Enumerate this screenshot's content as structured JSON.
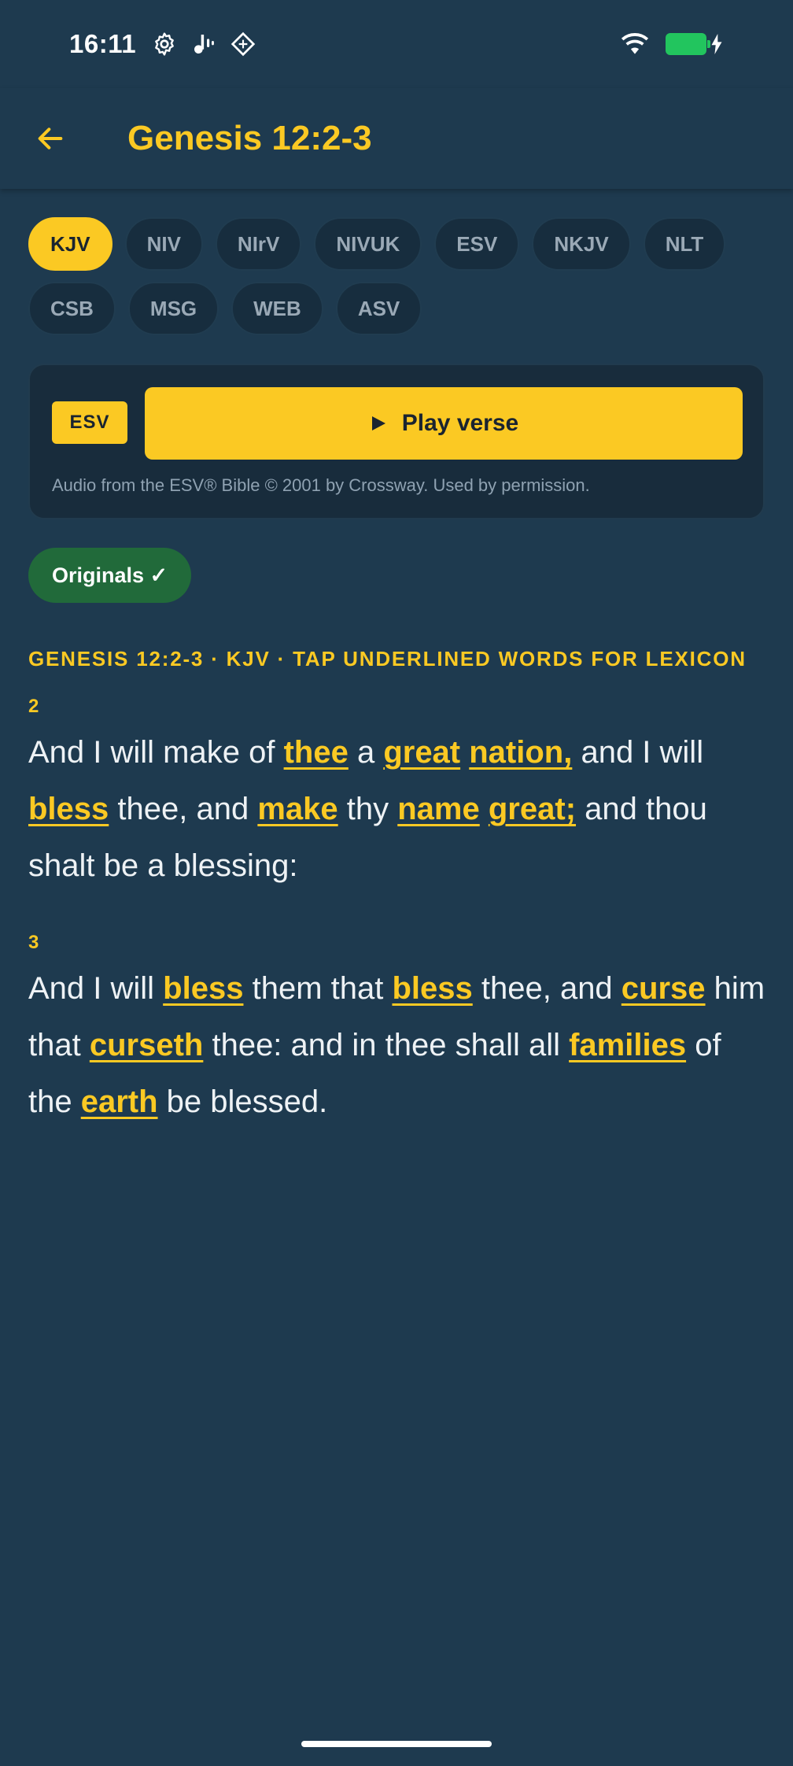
{
  "status": {
    "time": "16:11",
    "icons": [
      "settings-gear-icon",
      "audio-waves-icon",
      "diamond-grid-icon",
      "wifi-icon",
      "battery-charging-icon"
    ]
  },
  "appbar": {
    "title": "Genesis 12:2-3"
  },
  "translations": [
    "KJV",
    "NIV",
    "NIrV",
    "NIVUK",
    "ESV",
    "NKJV",
    "NLT",
    "CSB",
    "MSG",
    "WEB",
    "ASV"
  ],
  "selected_translation": "KJV",
  "audio": {
    "badge": "ESV",
    "play_label": "Play verse",
    "attribution": "Audio from the ESV® Bible © 2001 by Crossway. Used by permission."
  },
  "originals_label": "Originals ✓",
  "reference_header": "GENESIS 12:2-3 · KJV  ·  TAP UNDERLINED WORDS FOR LEXICON",
  "verses": [
    {
      "number": "2",
      "segments": [
        {
          "t": "And I will make of "
        },
        {
          "t": "thee",
          "lex": true
        },
        {
          "t": " a "
        },
        {
          "t": "great",
          "lex": true
        },
        {
          "t": " "
        },
        {
          "t": "nation,",
          "lex": true
        },
        {
          "t": " and I will "
        },
        {
          "t": "bless",
          "lex": true
        },
        {
          "t": " thee, and "
        },
        {
          "t": "make",
          "lex": true
        },
        {
          "t": " thy "
        },
        {
          "t": "name",
          "lex": true
        },
        {
          "t": " "
        },
        {
          "t": "great;",
          "lex": true
        },
        {
          "t": " and thou shalt be a blessing:"
        }
      ]
    },
    {
      "number": "3",
      "segments": [
        {
          "t": "And I will "
        },
        {
          "t": "bless",
          "lex": true
        },
        {
          "t": " them that "
        },
        {
          "t": "bless",
          "lex": true
        },
        {
          "t": " thee, and "
        },
        {
          "t": "curse",
          "lex": true
        },
        {
          "t": " him that "
        },
        {
          "t": "curseth",
          "lex": true
        },
        {
          "t": " thee: and in thee shall all "
        },
        {
          "t": "families",
          "lex": true
        },
        {
          "t": " of the "
        },
        {
          "t": "earth",
          "lex": true
        },
        {
          "t": " be blessed."
        }
      ]
    }
  ],
  "colors": {
    "background": "#1e3a4f",
    "accent": "#fbc923",
    "originals": "#216a3a"
  }
}
